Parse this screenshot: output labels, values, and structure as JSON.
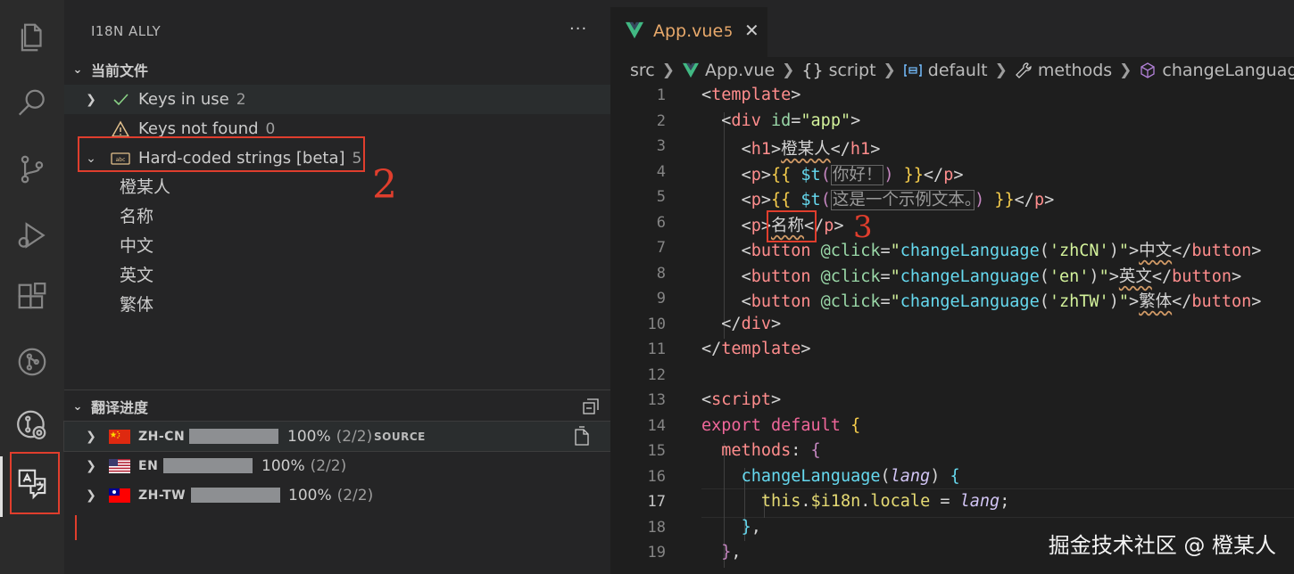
{
  "sidebar": {
    "title": "I18N ALLY",
    "more": "···",
    "current_file": {
      "header": "当前文件",
      "keys_in_use": {
        "label": "Keys in use",
        "count": "2"
      },
      "keys_not_found": {
        "label": "Keys not found",
        "count": "0"
      },
      "hardcoded": {
        "label": "Hard-coded strings [beta]",
        "count": "5"
      },
      "hardcoded_items": [
        "橙某人",
        "名称",
        "中文",
        "英文",
        "繁体"
      ]
    },
    "progress": {
      "header": "翻译进度",
      "locales": [
        {
          "code": "ZH-CN",
          "percent": "100%",
          "count": "(2/2)",
          "source": "SOURCE",
          "fill": 1.0
        },
        {
          "code": "EN",
          "percent": "100%",
          "count": "(2/2)",
          "source": "",
          "fill": 1.0
        },
        {
          "code": "ZH-TW",
          "percent": "100%",
          "count": "(2/2)",
          "source": "",
          "fill": 1.0
        }
      ]
    }
  },
  "editor": {
    "tab": {
      "name": "App.vue",
      "problems": "5",
      "close": "✕"
    },
    "breadcrumb": [
      "src",
      "App.vue",
      "script",
      "default",
      "methods",
      "changeLanguage"
    ],
    "line_numbers": [
      "1",
      "2",
      "3",
      "4",
      "5",
      "6",
      "7",
      "8",
      "9",
      "10",
      "11",
      "12",
      "13",
      "14",
      "15",
      "16",
      "17",
      "18",
      "19"
    ],
    "current_line": "17"
  },
  "annotations": {
    "two": "2",
    "three": "3"
  },
  "watermark": "掘金技术社区 @ 橙某人",
  "colors": {
    "annotation_red": "#e03e2d",
    "vue_green": "#41b883",
    "tab_orange": "#e8a96b"
  }
}
